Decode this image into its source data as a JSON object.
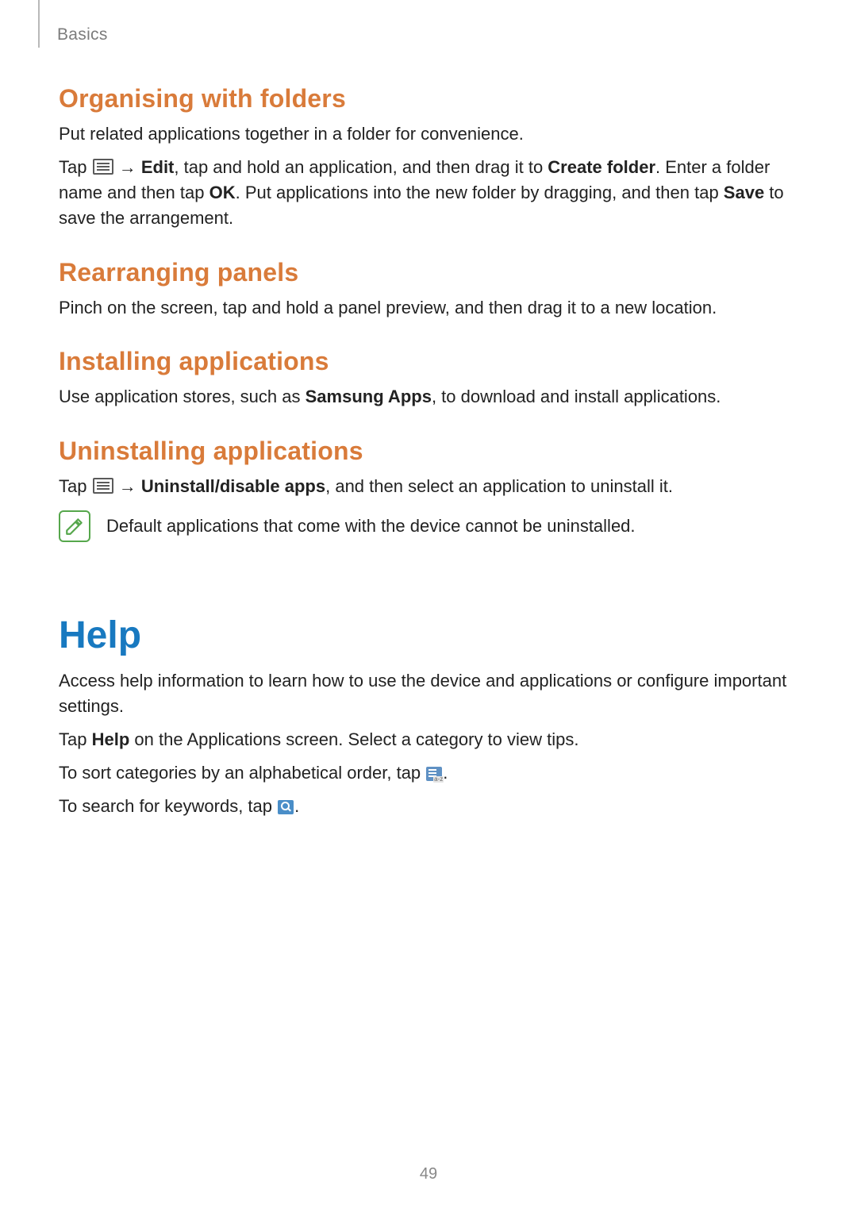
{
  "header": {
    "section": "Basics"
  },
  "sections": {
    "organising": {
      "title": "Organising with folders",
      "p1": "Put related applications together in a folder for convenience.",
      "p2_pre": "Tap ",
      "p2_arrow": " → ",
      "p2_edit": "Edit",
      "p2_mid1": ", tap and hold an application, and then drag it to ",
      "p2_create": "Create folder",
      "p2_mid2": ". Enter a folder name and then tap ",
      "p2_ok": "OK",
      "p2_mid3": ". Put applications into the new folder by dragging, and then tap ",
      "p2_save": "Save",
      "p2_post": " to save the arrangement."
    },
    "rearranging": {
      "title": "Rearranging panels",
      "p1": "Pinch on the screen, tap and hold a panel preview, and then drag it to a new location."
    },
    "installing": {
      "title": "Installing applications",
      "p1_pre": "Use application stores, such as ",
      "p1_bold": "Samsung Apps",
      "p1_post": ", to download and install applications."
    },
    "uninstalling": {
      "title": "Uninstalling applications",
      "p1_pre": "Tap ",
      "p1_arrow": " → ",
      "p1_bold": "Uninstall/disable apps",
      "p1_post": ", and then select an application to uninstall it.",
      "note": "Default applications that come with the device cannot be uninstalled."
    },
    "help": {
      "title": "Help",
      "p1": "Access help information to learn how to use the device and applications or configure important settings.",
      "p2_pre": "Tap ",
      "p2_bold": "Help",
      "p2_post": " on the Applications screen. Select a category to view tips.",
      "p3_pre": "To sort categories by an alphabetical order, tap ",
      "p3_post": ".",
      "p4_pre": "To search for keywords, tap ",
      "p4_post": "."
    }
  },
  "page_number": "49"
}
